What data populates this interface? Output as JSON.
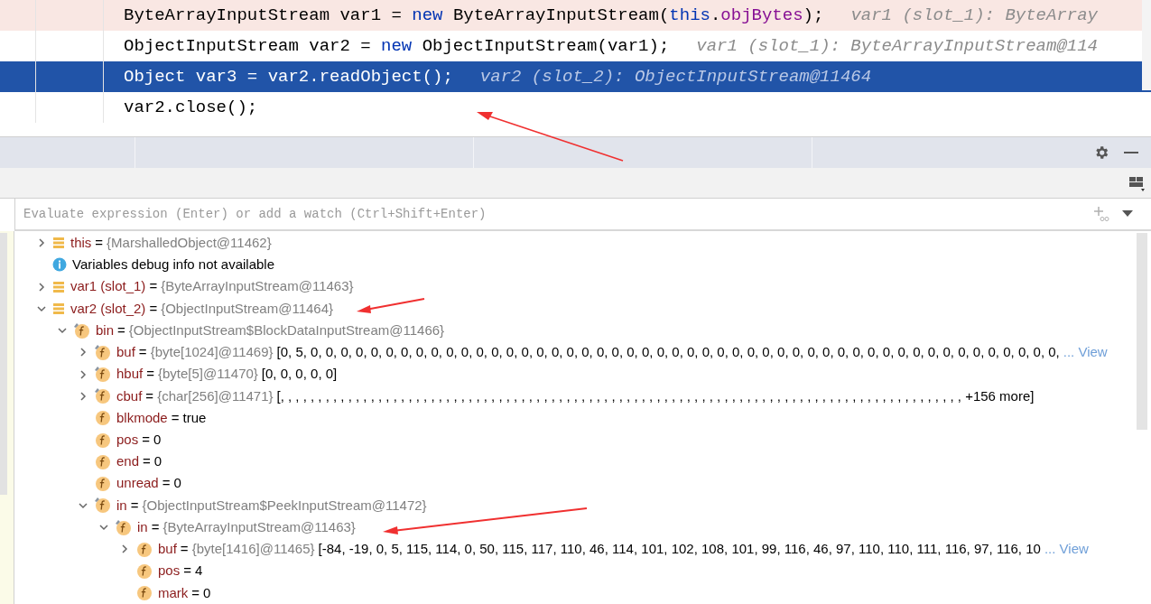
{
  "editor": {
    "lines": [
      {
        "breakpoint": true,
        "selected": false,
        "tokens": [
          {
            "kind": "plain",
            "text": "ByteArrayInputStream var1 = "
          },
          {
            "kind": "keyword",
            "text": "new"
          },
          {
            "kind": "plain",
            "text": " ByteArrayInputStream("
          },
          {
            "kind": "keyword",
            "text": "this"
          },
          {
            "kind": "plain",
            "text": "."
          },
          {
            "kind": "field",
            "text": "objBytes"
          },
          {
            "kind": "plain",
            "text": ");"
          }
        ],
        "hint": "var1 (slot_1): ByteArray"
      },
      {
        "breakpoint": false,
        "selected": false,
        "tokens": [
          {
            "kind": "plain",
            "text": "ObjectInputStream var2 = "
          },
          {
            "kind": "keyword",
            "text": "new"
          },
          {
            "kind": "plain",
            "text": " ObjectInputStream(var1);"
          }
        ],
        "hint": "var1 (slot_1): ByteArrayInputStream@114"
      },
      {
        "selected": true,
        "tokens": [
          {
            "kind": "plain",
            "text": "Object var3 = var2.readObject();"
          }
        ],
        "hint": "var2 (slot_2): ObjectInputStream@11464"
      },
      {
        "breakpoint": false,
        "selected": false,
        "tokens": [
          {
            "kind": "plain",
            "text": "var2.close();"
          }
        ]
      }
    ]
  },
  "watch": {
    "placeholder": "Evaluate expression (Enter) or add a watch (Ctrl+Shift+Enter)"
  },
  "tree": [
    {
      "kind": "var",
      "name": "this",
      "operator": "=",
      "type": "{MarshalledObject@11462}",
      "expanded": false
    },
    {
      "kind": "info",
      "text": "Variables debug info not available"
    },
    {
      "kind": "var",
      "name": "var1 (slot_1)",
      "operator": "=",
      "type": "{ByteArrayInputStream@11463}",
      "expanded": false
    },
    {
      "kind": "var",
      "name": "var2 (slot_2)",
      "operator": "=",
      "type": "{ObjectInputStream@11464}",
      "expanded": true,
      "children": [
        {
          "kind": "field",
          "final": true,
          "name": "bin",
          "operator": "=",
          "type": "{ObjectInputStream$BlockDataInputStream@11466}",
          "expanded": true,
          "children": [
            {
              "kind": "field",
              "final": true,
              "name": "buf",
              "operator": "=",
              "type": "{byte[1024]@11469}",
              "value": "[0, 5, 0, 0, 0, 0, 0, 0, 0, 0, 0, 0, 0, 0, 0, 0, 0, 0, 0, 0, 0, 0, 0, 0, 0, 0, 0, 0, 0, 0, 0, 0, 0, 0, 0, 0, 0, 0, 0, 0, 0, 0, 0, 0, 0, 0, 0, 0, 0, 0, 0, 0,",
              "link": "... View",
              "expanded": false
            },
            {
              "kind": "field",
              "final": true,
              "name": "hbuf",
              "operator": "=",
              "type": "{byte[5]@11470}",
              "value": "[0, 0, 0, 0, 0]",
              "expanded": false
            },
            {
              "kind": "field",
              "final": true,
              "name": "cbuf",
              "operator": "=",
              "type": "{char[256]@11471}",
              "value": "[, , , , , , , , , , , , , , , , , , , , , , , , , , , , , , , , , , , , , , , , , , , , , , , , , , , , , , , , , , , , , , , , , , , , , , , , , , , , , , , , , , , , , , , , , , , +156 more]",
              "expanded": false
            },
            {
              "kind": "field",
              "final": false,
              "name": "blkmode",
              "operator": "=",
              "value": "true"
            },
            {
              "kind": "field",
              "final": false,
              "name": "pos",
              "operator": "=",
              "value": "0"
            },
            {
              "kind": "field",
              "final": false,
              "name": "end",
              "operator": "=",
              "value": "0"
            },
            {
              "kind": "field",
              "final": false,
              "name": "unread",
              "operator": "=",
              "value": "0"
            },
            {
              "kind": "field",
              "final": true,
              "name": "in",
              "operator": "=",
              "type": "{ObjectInputStream$PeekInputStream@11472}",
              "expanded": true,
              "children": [
                {
                  "kind": "field",
                  "final": true,
                  "name": "in",
                  "operator": "=",
                  "type": "{ByteArrayInputStream@11463}",
                  "expanded": true,
                  "children": [
                    {
                      "kind": "field",
                      "final": false,
                      "name": "buf",
                      "operator": "=",
                      "type": "{byte[1416]@11465}",
                      "value": "[-84, -19, 0, 5, 115, 114, 0, 50, 115, 117, 110, 46, 114, 101, 102, 108, 101, 99, 116, 46, 97, 110, 110, 111, 116, 97, 116, 10",
                      "link": "... View",
                      "expanded": false
                    },
                    {
                      "kind": "field",
                      "final": false,
                      "name": "pos",
                      "operator": "=",
                      "value": "4"
                    },
                    {
                      "kind": "field",
                      "final": false,
                      "name": "mark",
                      "operator": "=",
                      "value": "0"
                    }
                  ]
                }
              ]
            }
          ]
        }
      ]
    }
  ]
}
